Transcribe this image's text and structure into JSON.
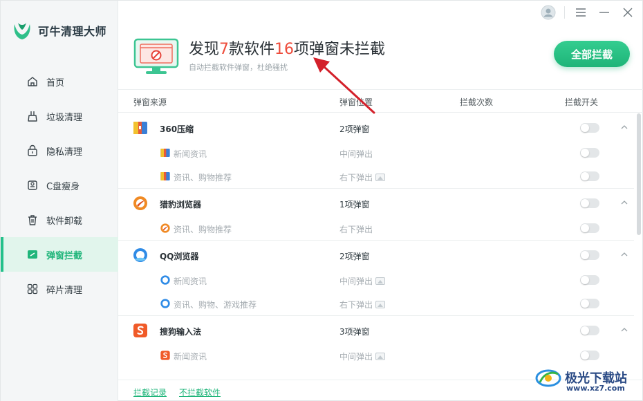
{
  "app": {
    "logo_text": "可牛清理大师"
  },
  "sidebar": {
    "items": [
      {
        "label": "首页",
        "icon": "home-icon"
      },
      {
        "label": "垃圾清理",
        "icon": "broom-icon"
      },
      {
        "label": "隐私清理",
        "icon": "lock-icon"
      },
      {
        "label": "C盘瘦身",
        "icon": "disk-icon"
      },
      {
        "label": "软件卸载",
        "icon": "trash-icon"
      },
      {
        "label": "弹窗拦截",
        "icon": "popup-icon",
        "active": true
      },
      {
        "label": "碎片清理",
        "icon": "grid-icon"
      }
    ]
  },
  "header": {
    "prefix": "发现",
    "software_count": "7",
    "mid": "款软件",
    "popup_count": "16",
    "suffix": "项弹窗未拦截",
    "subtitle": "自动拦截软件弹窗，杜绝骚扰",
    "block_all_label": "全部拦截"
  },
  "table": {
    "headers": {
      "source": "弹窗来源",
      "position": "弹窗位置",
      "times": "拦截次数",
      "switch": "拦截开关"
    },
    "groups": [
      {
        "name": "360压缩",
        "count": "2项弹窗",
        "icon": "360zip-icon",
        "items": [
          {
            "name": "新闻资讯",
            "pos": "中间弹出",
            "has_img": false
          },
          {
            "name": "资讯、购物推荐",
            "pos": "右下弹出",
            "has_img": true
          }
        ]
      },
      {
        "name": "猎豹浏览器",
        "count": "1项弹窗",
        "icon": "cheetah-browser-icon",
        "items": [
          {
            "name": "资讯、购物推荐",
            "pos": "右下弹出",
            "has_img": false
          }
        ]
      },
      {
        "name": "QQ浏览器",
        "count": "2项弹窗",
        "icon": "qq-browser-icon",
        "items": [
          {
            "name": "新闻资讯",
            "pos": "中间弹出",
            "has_img": true
          },
          {
            "name": "资讯、购物、游戏推荐",
            "pos": "右下弹出",
            "has_img": true
          }
        ]
      },
      {
        "name": "搜狗输入法",
        "count": "3项弹窗",
        "icon": "sogou-input-icon",
        "items": [
          {
            "name": "新闻资讯",
            "pos": "中间弹出",
            "has_img": true
          }
        ]
      }
    ]
  },
  "footer": {
    "history_link": "拦截记录",
    "whitelist_link": "不拦截软件"
  },
  "watermark": {
    "text": "极光下载站",
    "url": "www.xz7.com"
  },
  "colors": {
    "accent": "#1fb57a",
    "highlight_number": "#ee4b3a",
    "annotation_arrow": "#d3202a"
  }
}
